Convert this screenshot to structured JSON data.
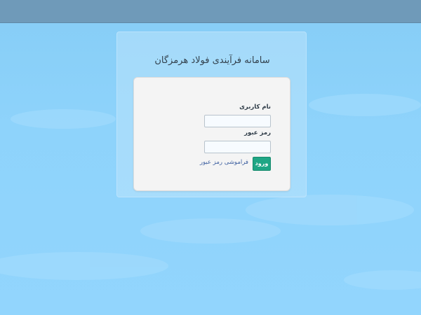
{
  "app": {
    "title": "سامانه فرآیندی فولاد هرمزگان"
  },
  "login": {
    "username_label": "نام کاربری",
    "username_value": "",
    "password_label": "رمز عبور",
    "password_value": "",
    "submit_label": "ورود",
    "forgot_label": "فراموشی رمز عبور"
  },
  "colors": {
    "topbar": "#6f9ab9",
    "background": "#8ed3fb",
    "card": "#f4f4f4",
    "button": "#1fa685",
    "link": "#3d5fa0"
  }
}
